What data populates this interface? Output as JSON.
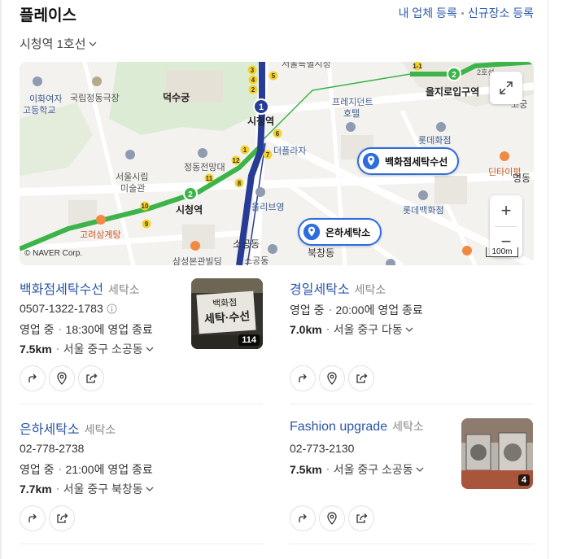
{
  "header": {
    "title": "플레이스",
    "link_register": "내 업체 등록",
    "link_new": "신규장소 등록"
  },
  "filter": {
    "station": "시청역 1호선"
  },
  "map": {
    "labels": {
      "girls_school_1": "이화여자",
      "girls_school_2": "고등학교",
      "theater": "국립정동극장",
      "deoksugung": "덕수궁",
      "seoul_museum_1": "서울시립",
      "seoul_museum_2": "미술관",
      "jeongdong": "정동전망대",
      "cityhall_station_1": "시청역",
      "cityhall_station_2": "시청역",
      "plaza_hotel": "더플라자",
      "president_hotel_1": "프레지던트",
      "president_hotel_2": "호텔",
      "lotte_hwajeom": "롯데화점",
      "euljiro": "을지로입구역",
      "dinner": "딘타이펑",
      "myeongdong": "명동",
      "lotte_department": "롯데백화점",
      "olive": "올리브영",
      "sogong": "소공동",
      "sogong2": "소공동",
      "bukchang": "북창동",
      "gore": "고려삼계탕",
      "samsung": "삼성본관빌딩",
      "line_label": "2호선",
      "copyright": "© NAVER Corp.",
      "scale": "100m",
      "partial_top": "서울특별시청",
      "partial_right": "고궁"
    },
    "pins": {
      "pin_1": "백화점세탁수선",
      "pin_2": "은하세탁소"
    },
    "zoom_in": "+",
    "zoom_out": "−"
  },
  "places": [
    {
      "name": "백화점세탁수선",
      "category": "세탁소",
      "phone": "0507-1322-1783",
      "status": "영업 중",
      "hours": "18:30에 영업 종료",
      "distance": "7.5km",
      "address": "서울 중구 소공동",
      "photo_count": "114",
      "sign_text_1": "백화점",
      "sign_text_2": "세탁·수선"
    },
    {
      "name": "경일세탁소",
      "category": "세탁소",
      "status": "영업 중",
      "hours": "20:00에 영업 종료",
      "distance": "7.0km",
      "address": "서울 중구 다동"
    },
    {
      "name": "은하세탁소",
      "category": "세탁소",
      "phone": "02-778-2738",
      "status": "영업 중",
      "hours": "21:00에 영업 종료",
      "distance": "7.7km",
      "address": "서울 중구 북창동"
    },
    {
      "name": "Fashion upgrade",
      "category": "세탁소",
      "phone": "02-773-2130",
      "distance": "7.5km",
      "address": "서울 중구 소공동",
      "photo_count": "4"
    }
  ],
  "colors": {
    "link": "#2a55a6",
    "line1": "#263c96",
    "line2": "#3cb44a",
    "pin_border": "#2d6cdf"
  },
  "icons": [
    "chevron-down-icon",
    "info-icon",
    "directions-icon",
    "location-pin-icon",
    "share-icon",
    "expand-icon"
  ]
}
